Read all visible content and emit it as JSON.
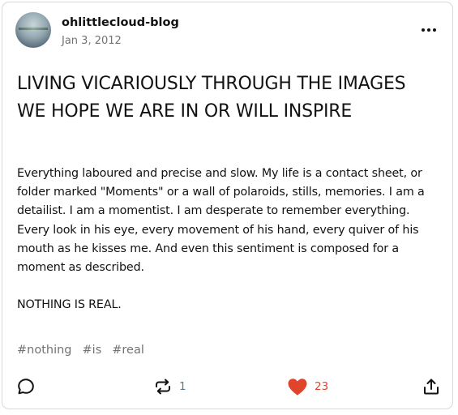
{
  "post": {
    "blog_name": "ohlittlecloud-blog",
    "date": "Jan 3, 2012",
    "title": "LIVING VICARIOUSLY THROUGH THE IMAGES WE HOPE WE ARE IN OR WILL INSPIRE",
    "body": "Everything laboured and precise and slow. My life is a contact sheet, or folder marked \"Moments\" or a wall of polaroids, stills, memories. I am a detailist. I am a momentist. I am desperate to remember everything. Every look in his eye, every movement of his hand, every quiver of his mouth as he kisses me. And even this sentiment is composed for a moment as described.",
    "closing": "NOTHING IS REAL.",
    "tags": [
      "#nothing",
      "#is",
      "#real"
    ]
  },
  "actions": {
    "reply_icon": "speech-bubble-icon",
    "reblog_icon": "reblog-arrows-icon",
    "reblog_count": "1",
    "like_icon": "heart-icon",
    "like_count": "23",
    "share_icon": "share-upload-icon"
  },
  "colors": {
    "text": "#121212",
    "secondary_text": "#737373",
    "like_red": "#e0442b",
    "card_border": "#d9d9d9"
  }
}
